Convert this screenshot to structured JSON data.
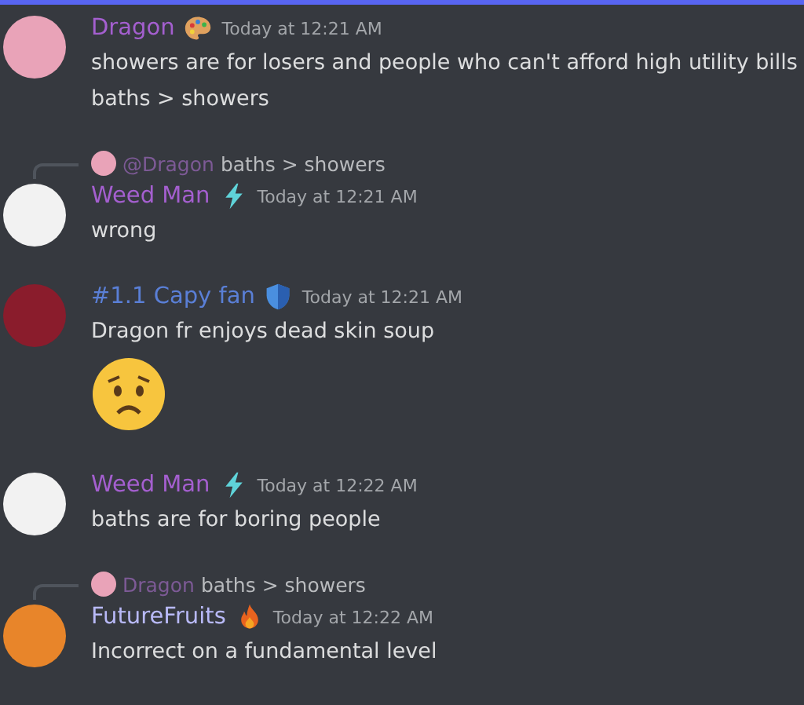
{
  "messages": [
    {
      "author": {
        "name": "Dragon",
        "color": "#a45fcf"
      },
      "badge": {
        "kind": "palette"
      },
      "time": "Today at 12:21 AM",
      "avatar": {
        "color": "#e9a3b8"
      },
      "content": [
        {
          "kind": "text",
          "text": "showers are for losers and people who can't afford high utility bills"
        },
        {
          "kind": "text",
          "text": "baths > showers"
        }
      ]
    },
    {
      "author": {
        "name": "Weed Man",
        "color": "#a45fcf"
      },
      "badge": {
        "kind": "bolt"
      },
      "time": "Today at 12:21 AM",
      "avatar": {
        "color": "#f2f2f2"
      },
      "reply": {
        "name": "@Dragon",
        "text": "baths > showers",
        "avatar": {
          "color": "#e9a3b8"
        }
      },
      "content": [
        {
          "kind": "text",
          "text": "wrong"
        }
      ]
    },
    {
      "author": {
        "name": "#1.1 Capy fan",
        "color": "#5a7fd6"
      },
      "badge": {
        "kind": "shield"
      },
      "time": "Today at 12:21 AM",
      "avatar": {
        "color": "#8a1c2c"
      },
      "content": [
        {
          "kind": "text",
          "text": "Dragon fr enjoys dead skin soup"
        },
        {
          "kind": "emoji"
        }
      ]
    },
    {
      "author": {
        "name": "Weed Man",
        "color": "#a45fcf"
      },
      "badge": {
        "kind": "bolt"
      },
      "time": "Today at 12:22 AM",
      "avatar": {
        "color": "#f2f2f2"
      },
      "content": [
        {
          "kind": "text",
          "text": "baths are for boring people"
        }
      ]
    },
    {
      "author": {
        "name": "FutureFruits",
        "color": "#b8b9f7"
      },
      "badge": {
        "kind": "flame"
      },
      "time": "Today at 12:22 AM",
      "avatar": {
        "color": "#e8852a"
      },
      "reply": {
        "name": "Dragon",
        "text": "baths > showers",
        "avatar": {
          "color": "#e9a3b8"
        }
      },
      "content": [
        {
          "kind": "text",
          "text": "Incorrect on a fundamental level"
        }
      ]
    }
  ]
}
